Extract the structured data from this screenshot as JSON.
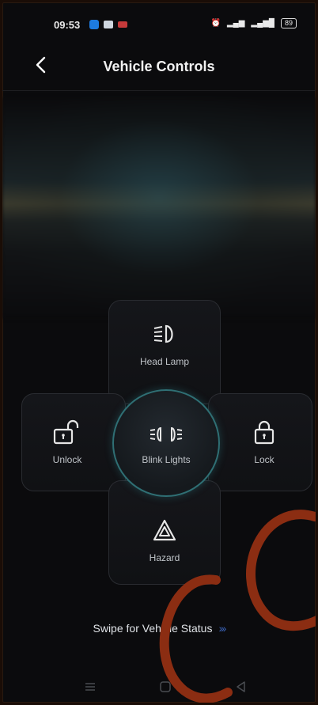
{
  "status_bar": {
    "time": "09:53",
    "battery": "89"
  },
  "header": {
    "title": "Vehicle Controls"
  },
  "controls": {
    "head_lamp": "Head Lamp",
    "unlock": "Unlock",
    "blink_lights": "Blink Lights",
    "lock": "Lock",
    "hazard": "Hazard"
  },
  "footer": {
    "swipe_text": "Swipe for Vehicle Status",
    "swipe_chevrons": "›››"
  },
  "colors": {
    "accent_teal": "#2f6f74",
    "chevron_blue": "#3a63b8",
    "watermark": "#8b2d12"
  }
}
